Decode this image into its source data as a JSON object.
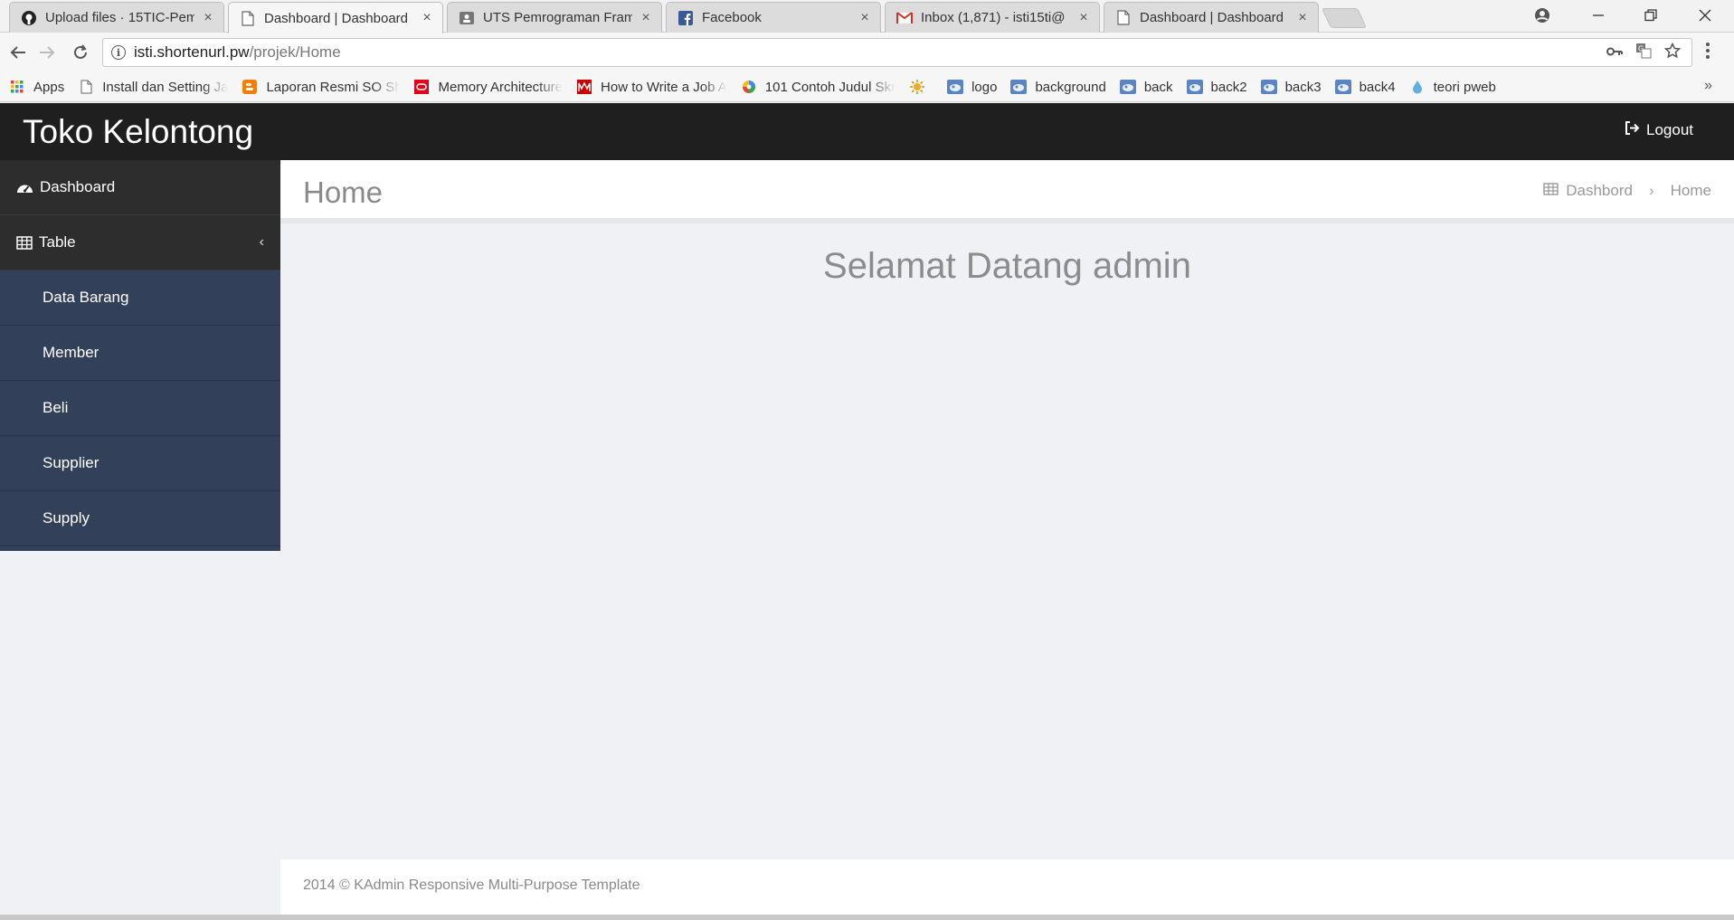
{
  "browser": {
    "tabs": [
      {
        "title": "Upload files · 15TIC-Pem",
        "icon": "github-icon",
        "active": false
      },
      {
        "title": "Dashboard | Dashboard",
        "icon": "page-icon",
        "active": true
      },
      {
        "title": "UTS Pemrograman Fram",
        "icon": "contact-card-icon",
        "active": false
      },
      {
        "title": "Facebook",
        "icon": "facebook-icon",
        "active": false
      },
      {
        "title": "Inbox (1,871) - isti15ti@",
        "icon": "gmail-icon",
        "active": false
      },
      {
        "title": "Dashboard | Dashboard",
        "icon": "page-icon",
        "active": false
      }
    ],
    "close_glyph": "×",
    "url_host": "isti.shortenurl.pw",
    "url_path": "/projek/Home",
    "bookmarks": [
      {
        "label": "Apps",
        "icon": "apps-grid-icon"
      },
      {
        "label": "Install dan Setting Ja",
        "icon": "page-icon"
      },
      {
        "label": "Laporan Resmi SO Sh",
        "icon": "blogger-icon"
      },
      {
        "label": "Memory Architecture",
        "icon": "oracle-icon"
      },
      {
        "label": "How to Write a Job A",
        "icon": "m-icon"
      },
      {
        "label": "101 Contoh Judul Skr",
        "icon": "pinwheel-icon"
      },
      {
        "label": "",
        "icon": "sun-icon"
      },
      {
        "label": "logo",
        "icon": "image-icon"
      },
      {
        "label": "background",
        "icon": "image-icon"
      },
      {
        "label": "back",
        "icon": "image-icon"
      },
      {
        "label": "back2",
        "icon": "image-icon"
      },
      {
        "label": "back3",
        "icon": "image-icon"
      },
      {
        "label": "back4",
        "icon": "image-icon"
      },
      {
        "label": "teori pweb",
        "icon": "drop-icon"
      }
    ],
    "more_glyph": "»"
  },
  "app": {
    "brand": "Toko Kelontong",
    "logout_label": "Logout",
    "sidebar": {
      "dashboard_label": "Dashboard",
      "table_label": "Table",
      "table_chevron": "‹",
      "sub_items": [
        "Data Barang",
        "Member",
        "Beli",
        "Supplier",
        "Supply"
      ]
    },
    "page_title": "Home",
    "breadcrumb": {
      "root": "Dashbord",
      "separator": "›",
      "current": "Home"
    },
    "welcome": "Selamat Datang admin",
    "footer": "2014 © KAdmin Responsive Multi-Purpose Template"
  },
  "colors": {
    "header_bg": "#1f1f1f",
    "sidebar_bg": "#33405a",
    "sidebar_top_bg": "#2d2d2d",
    "content_bg": "#f0f1f4"
  }
}
